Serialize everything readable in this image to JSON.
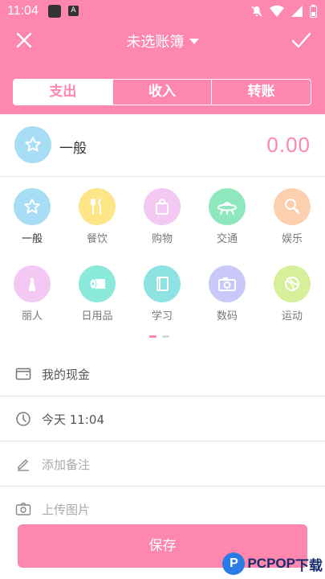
{
  "status_bar": {
    "time": "11:04",
    "app_icon_label": "A"
  },
  "top_bar": {
    "book_title": "未选账簿"
  },
  "tabs": [
    {
      "label": "支出",
      "active": true
    },
    {
      "label": "收入",
      "active": false
    },
    {
      "label": "转账",
      "active": false
    }
  ],
  "amount": {
    "category": "一般",
    "value": "0.00"
  },
  "categories": [
    {
      "label": "一般",
      "icon": "star-icon",
      "color": "#a8def5",
      "selected": true
    },
    {
      "label": "餐饮",
      "icon": "utensils-icon",
      "color": "#fde588"
    },
    {
      "label": "购物",
      "icon": "shopping-bag-icon",
      "color": "#f3c8f2"
    },
    {
      "label": "交通",
      "icon": "ufo-icon",
      "color": "#8fe8bd"
    },
    {
      "label": "娱乐",
      "icon": "ice-cream-icon",
      "color": "#fccfae"
    },
    {
      "label": "丽人",
      "icon": "lipstick-icon",
      "color": "#f3c8f2"
    },
    {
      "label": "日用品",
      "icon": "tissue-roll-icon",
      "color": "#8ceadb"
    },
    {
      "label": "学习",
      "icon": "book-icon",
      "color": "#8ce3e2"
    },
    {
      "label": "数码",
      "icon": "camera-icon",
      "color": "#c9c8f8"
    },
    {
      "label": "运动",
      "icon": "ball-icon",
      "color": "#d6ef99"
    }
  ],
  "pager": {
    "pages": 2,
    "current": 1,
    "active_color": "#fd87ad",
    "inactive_color": "#d8d8d8"
  },
  "fields": {
    "account": "我的现金",
    "date": "今天  11:04",
    "note_placeholder": "添加备注",
    "image_placeholder": "上传图片"
  },
  "save_label": "保存",
  "watermark": {
    "brand": "PCPOP",
    "suffix": "下载"
  },
  "colors": {
    "accent": "#fd87ad"
  }
}
